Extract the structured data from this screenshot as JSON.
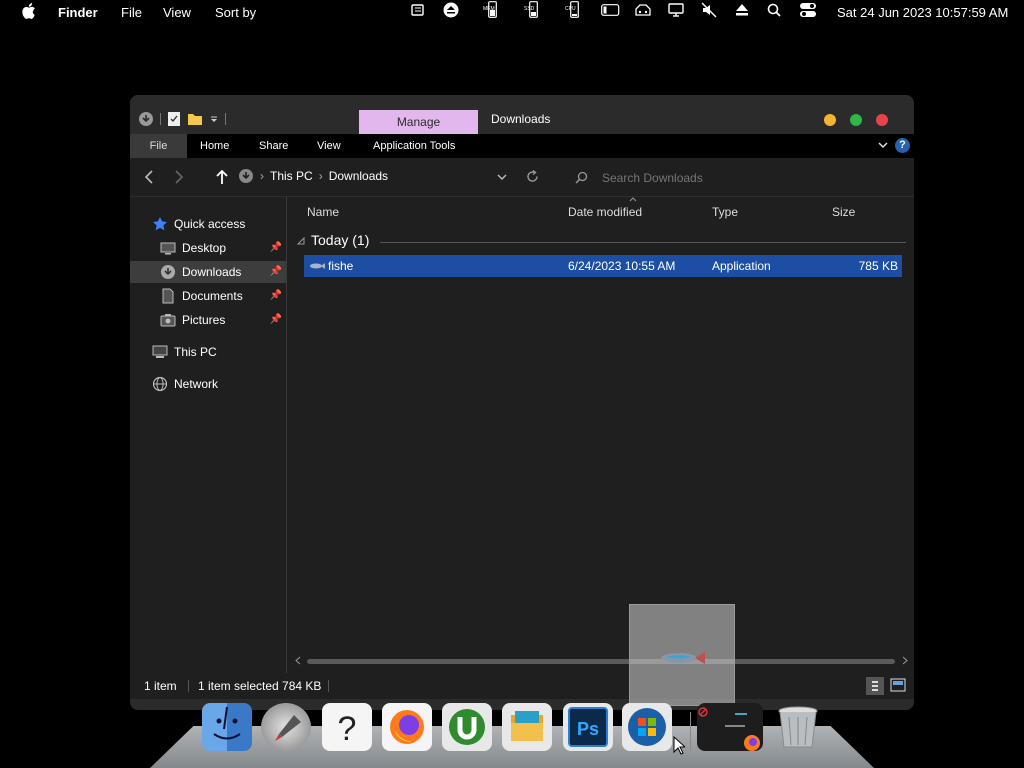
{
  "menubar": {
    "app_name": "Finder",
    "menus": [
      "File",
      "View",
      "Sort by"
    ],
    "status_icons": [
      "memory-icon",
      "ssd-icon",
      "cpu-icon",
      "wifi-icon",
      "display-icon",
      "mute-icon",
      "eject-icon",
      "search-icon",
      "control-center-icon"
    ],
    "clock": "Sat 24 Jun 2023  10:57:59 AM",
    "labels": {
      "mem": "MEM",
      "ssd": "SSD",
      "cpu": "CPU"
    }
  },
  "window": {
    "title": "Downloads",
    "context_tab": "Manage",
    "ribbon_tabs": [
      "File",
      "Home",
      "Share",
      "View",
      "Application Tools"
    ],
    "help_label": "?",
    "breadcrumb": [
      "This PC",
      "Downloads"
    ],
    "search_placeholder": "Search Downloads",
    "sidebar": {
      "quick_access": "Quick access",
      "items": [
        {
          "label": "Desktop",
          "icon": "desktop-icon",
          "pinned": true
        },
        {
          "label": "Downloads",
          "icon": "download-folder-icon",
          "pinned": true,
          "selected": true
        },
        {
          "label": "Documents",
          "icon": "documents-icon",
          "pinned": true
        },
        {
          "label": "Pictures",
          "icon": "pictures-icon",
          "pinned": true
        }
      ],
      "this_pc": "This PC",
      "network": "Network"
    },
    "columns": [
      "Name",
      "Date modified",
      "Type",
      "Size"
    ],
    "group_label": "Today (1)",
    "files": [
      {
        "name": "fishe",
        "date": "6/24/2023 10:55 AM",
        "type": "Application",
        "size": "785 KB",
        "selected": true
      }
    ],
    "status": {
      "count": "1 item",
      "selection": "1 item selected  784 KB"
    }
  },
  "dock": {
    "apps": [
      "finder-icon",
      "launchpad-icon",
      "help-icon",
      "firefox-icon",
      "utorrent-icon",
      "folder-app-icon",
      "photoshop-icon",
      "windows-icon",
      "terminal-preview-icon",
      "trash-icon"
    ]
  },
  "colors": {
    "accent_selection": "#1c4fa3",
    "manage_tab": "#e2b7ee",
    "close": "#e8434a",
    "minimize": "#f5b530",
    "maximize": "#2fb84a"
  }
}
